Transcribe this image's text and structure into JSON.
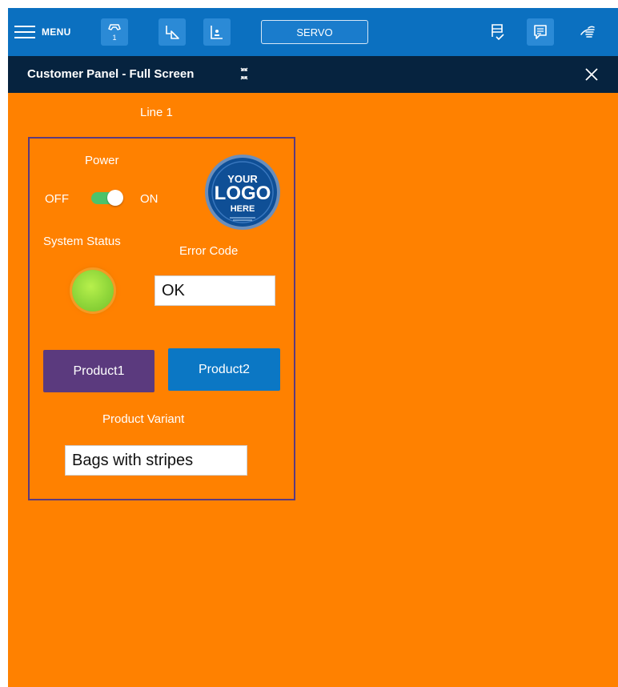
{
  "toolbar": {
    "menu_label": "MENU",
    "tool_badge": "1",
    "servo_label": "SERVO",
    "colors": {
      "background": "#0b70c0",
      "icon_tile": "#2b8ad6"
    },
    "icons": [
      "menu-icon",
      "tool-icon",
      "frame-icon",
      "user-frame-icon",
      "checklist-icon",
      "message-icon",
      "hand-icon"
    ]
  },
  "panel": {
    "title": "Customer Panel - Full Screen",
    "colors": {
      "titlebar": "#06233f",
      "canvas": "#ff8100"
    }
  },
  "canvas": {
    "line_label": "Line 1",
    "power": {
      "label": "Power",
      "off_label": "OFF",
      "on_label": "ON",
      "state": "on"
    },
    "logo": {
      "line1": "YOUR",
      "line2": "LOGO",
      "line3": "HERE"
    },
    "system_status": {
      "label": "System Status",
      "led_color": "#8fd63a"
    },
    "error_code": {
      "label": "Error Code",
      "value": "OK"
    },
    "buttons": {
      "product1": {
        "label": "Product1",
        "color": "#5b3a7e"
      },
      "product2": {
        "label": "Product2",
        "color": "#0b77c4"
      }
    },
    "product_variant": {
      "label": "Product Variant",
      "value": "Bags with stripes"
    }
  }
}
